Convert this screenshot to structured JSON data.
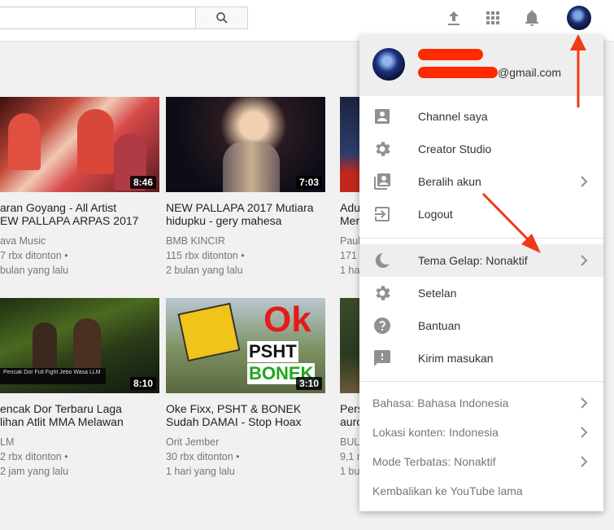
{
  "header": {
    "search_placeholder": ""
  },
  "videos": [
    {
      "title": "aran Goyang - All Artist\nEW PALLAPA ARPAS 2017",
      "channel": "ava Music",
      "views": "7 rbx ditonton •",
      "age": "bulan yang lalu",
      "duration": "8:46"
    },
    {
      "title": "NEW PALLAPA 2017 Mutiara\nhidupku - gery mahesa",
      "channel": "BMB KINCIR",
      "views": "115 rbx ditonton •",
      "age": "2 bulan yang lalu",
      "duration": "7:03"
    },
    {
      "title": "Adu\nMer",
      "channel": "Paul",
      "views": "171",
      "age": "1 ha",
      "duration": ""
    },
    {
      "title": "encak Dor Terbaru Laga\nlihan Atlit MMA Melawan",
      "channel": "LM",
      "views": "2 rbx ditonton •",
      "age": "2 jam yang lalu",
      "duration": "8:10",
      "thumb_caption": "Pencak Dor Full Fight Jebo Wasa LLM"
    },
    {
      "title": "Oke Fixx, PSHT & BONEK\nSudah DAMAI - Stop Hoax",
      "channel": "Orit Jember",
      "views": "30 rbx ditonton •",
      "age": "1 hari yang lalu",
      "duration": "3:10",
      "thumb_text": [
        "Ok",
        "PSHT",
        "BONEK"
      ]
    },
    {
      "title": "Pers\nauro",
      "channel": "BUL",
      "views": "9,1 r",
      "age": "1 bu",
      "duration": ""
    }
  ],
  "account_menu": {
    "email_suffix": "@gmail.com",
    "items": [
      {
        "label": "Channel saya",
        "icon": "person-box-icon"
      },
      {
        "label": "Creator Studio",
        "icon": "gear-icon"
      },
      {
        "label": "Beralih akun",
        "icon": "switch-account-icon"
      },
      {
        "label": "Logout",
        "icon": "logout-icon"
      },
      {
        "label": "Tema Gelap: Nonaktif",
        "icon": "moon-icon"
      },
      {
        "label": "Setelan",
        "icon": "gear-icon"
      },
      {
        "label": "Bantuan",
        "icon": "help-icon"
      },
      {
        "label": "Kirim masukan",
        "icon": "feedback-icon"
      }
    ],
    "settings": [
      {
        "label": "Bahasa: Bahasa Indonesia"
      },
      {
        "label": "Lokasi konten: Indonesia"
      },
      {
        "label": "Mode Terbatas: Nonaktif"
      },
      {
        "label": "Kembalikan ke YouTube lama"
      }
    ]
  },
  "colors": {
    "redaction": "#ff2a00",
    "annotation_arrow": "#f03a17",
    "menu_hover": "#eeeeee"
  }
}
